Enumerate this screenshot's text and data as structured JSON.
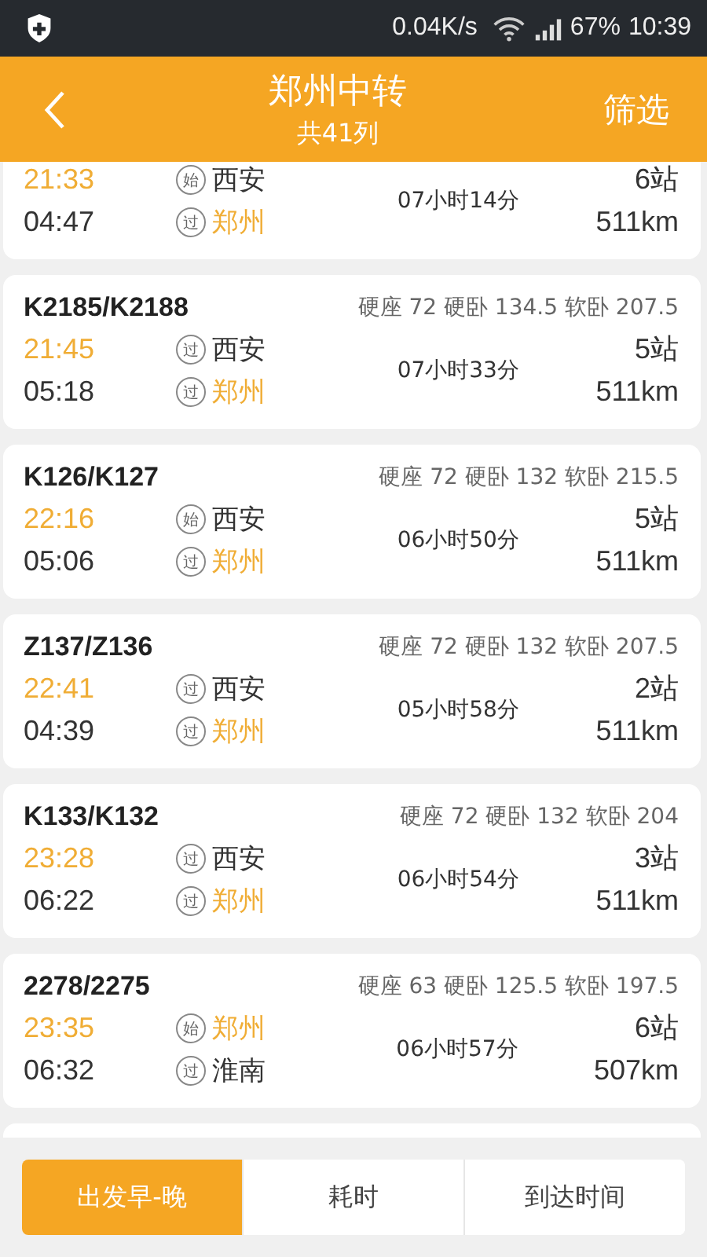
{
  "status_bar": {
    "speed": "0.04K/s",
    "battery": "67%",
    "time": "10:39"
  },
  "header": {
    "title": "郑州中转",
    "subtitle": "共41列",
    "action": "筛选"
  },
  "trains": [
    {
      "depart": "21:33",
      "arrive": "04:47",
      "from": {
        "mark": "始",
        "name": "西安",
        "highlight": false
      },
      "to": {
        "mark": "过",
        "name": "郑州",
        "highlight": true
      },
      "duration": "07小时14分",
      "stops": "6站",
      "distance": "511km"
    },
    {
      "number": "K2185/K2188",
      "prices": "硬座 72 硬卧 134.5 软卧 207.5",
      "depart": "21:45",
      "arrive": "05:18",
      "from": {
        "mark": "过",
        "name": "西安",
        "highlight": false
      },
      "to": {
        "mark": "过",
        "name": "郑州",
        "highlight": true
      },
      "duration": "07小时33分",
      "stops": "5站",
      "distance": "511km"
    },
    {
      "number": "K126/K127",
      "prices": "硬座 72 硬卧 132 软卧 215.5",
      "depart": "22:16",
      "arrive": "05:06",
      "from": {
        "mark": "始",
        "name": "西安",
        "highlight": false
      },
      "to": {
        "mark": "过",
        "name": "郑州",
        "highlight": true
      },
      "duration": "06小时50分",
      "stops": "5站",
      "distance": "511km"
    },
    {
      "number": "Z137/Z136",
      "prices": "硬座 72 硬卧 132 软卧 207.5",
      "depart": "22:41",
      "arrive": "04:39",
      "from": {
        "mark": "过",
        "name": "西安",
        "highlight": false
      },
      "to": {
        "mark": "过",
        "name": "郑州",
        "highlight": true
      },
      "duration": "05小时58分",
      "stops": "2站",
      "distance": "511km"
    },
    {
      "number": "K133/K132",
      "prices": "硬座 72 硬卧 132 软卧 204",
      "depart": "23:28",
      "arrive": "06:22",
      "from": {
        "mark": "过",
        "name": "西安",
        "highlight": false
      },
      "to": {
        "mark": "过",
        "name": "郑州",
        "highlight": true
      },
      "duration": "06小时54分",
      "stops": "3站",
      "distance": "511km"
    },
    {
      "number": "2278/2275",
      "prices": "硬座 63 硬卧 125.5 软卧 197.5",
      "depart": "23:35",
      "arrive": "06:32",
      "from": {
        "mark": "始",
        "name": "郑州",
        "highlight": true
      },
      "to": {
        "mark": "过",
        "name": "淮南",
        "highlight": false
      },
      "duration": "06小时57分",
      "stops": "6站",
      "distance": "507km"
    }
  ],
  "sort_tabs": [
    {
      "label": "出发早-晚",
      "selected": true
    },
    {
      "label": "耗时",
      "selected": false
    },
    {
      "label": "到达时间",
      "selected": false
    }
  ]
}
